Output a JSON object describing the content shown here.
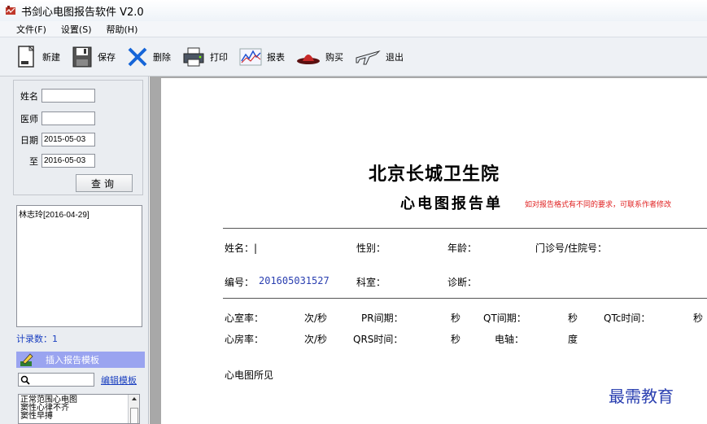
{
  "window": {
    "title": "书剑心电图报告软件 V2.0"
  },
  "menu": [
    "文件(F)",
    "设置(S)",
    "帮助(H)"
  ],
  "toolbar": {
    "new": "新建",
    "save": "保存",
    "delete": "删除",
    "print": "打印",
    "report": "报表",
    "buy": "购买",
    "exit": "退出"
  },
  "search": {
    "name_label": "姓名",
    "doctor_label": "医师",
    "date_label": "日期",
    "to_label": "至",
    "name_value": "",
    "doctor_value": "",
    "date_from": "2015-05-03",
    "date_to": "2016-05-03",
    "query_button": "查询"
  },
  "records": {
    "items": [
      "林志玲[2016-04-29]"
    ],
    "count_text": "计录数：1"
  },
  "templates": {
    "insert_label": "插入报告模板",
    "edit_link": "编辑模板",
    "search_value": "",
    "items": [
      "正常范围心电图",
      "窦性心律不齐",
      "窦性早搏"
    ]
  },
  "report": {
    "hospital": "北京长城卫生院",
    "title": "心电图报告单",
    "note": "如对报告格式有不同的要求，可联系作者修改",
    "name_label": "姓名：|",
    "gender_label": "性别：",
    "age_label": "年龄：",
    "record_no_label": "门诊号/住院号：",
    "serial_label": "编号：",
    "serial_value": "201605031527",
    "dept_label": "科室：",
    "diagnosis_label": "诊断：",
    "ventricular_rate": "心室率：",
    "atrial_rate": "心房率：",
    "unit_bpm1": "次/秒",
    "unit_bpm2": "次/秒",
    "pr": "PR间期：",
    "qrs": "QRS时间：",
    "unit_s1": "秒",
    "unit_s2": "秒",
    "qt": "QT间期：",
    "axis": "电轴：",
    "unit_s3": "秒",
    "unit_deg": "度",
    "qtc": "QTc时间：",
    "unit_s4": "秒",
    "findings": "心电图所见"
  },
  "watermark": "最需教育",
  "colors": {
    "link_blue": "#1a3fc0",
    "note_red": "#e02020",
    "template_bar": "#9aa4f0"
  }
}
